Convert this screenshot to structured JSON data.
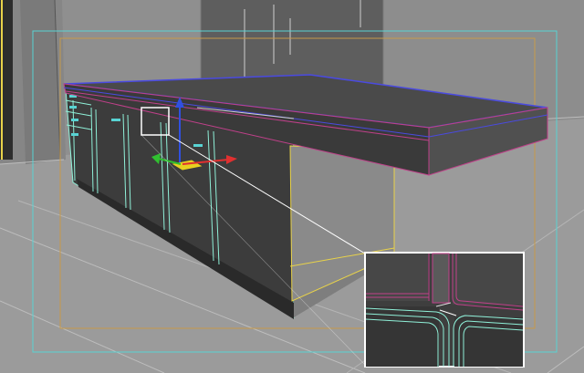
{
  "viewport": {
    "view": "perspective",
    "shading": "wireframe-over-shaded",
    "colors": {
      "background": "#8f8f8f",
      "floor": "#9a9a9a",
      "grid": "#bdbdbd",
      "safe_frame_outer": "#58d3d3",
      "safe_frame_inner": "#c79a4a",
      "edge_yellow": "#e8d24a",
      "countertop_edge_blue": "#4a4ae0",
      "countertop_edge_magenta": "#c0408a",
      "cabinet_edge_cyan": "#8ff0d8",
      "mesh_fill": "#3f3f3f"
    }
  },
  "scene": {
    "objects": [
      "kitchen-island-countertop",
      "kitchen-island-cabinets",
      "wall-panel"
    ],
    "selected": "kitchen-island-countertop"
  },
  "gizmo": {
    "type": "move-gizmo",
    "axes": [
      "x",
      "y",
      "z"
    ],
    "axis_colors": {
      "x": "#e03030",
      "y": "#30c030",
      "z": "#3050e0",
      "plane": "#e8d020"
    }
  },
  "zoom_inset": {
    "type": "detail-magnifier",
    "frame_color": "#ffffff"
  }
}
